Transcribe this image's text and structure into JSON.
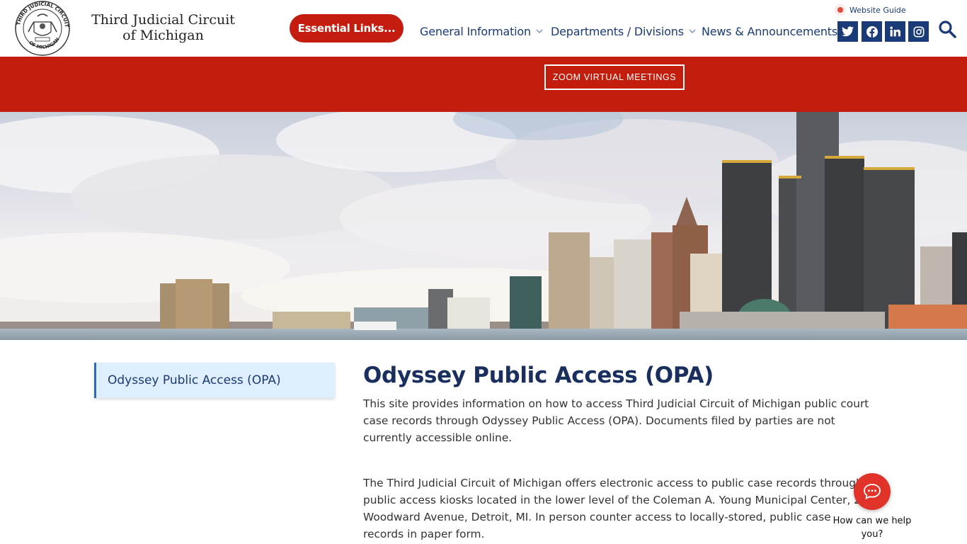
{
  "header": {
    "seal_text_top": "THIRD JUDICIAL CIRCUIT",
    "seal_text_bottom": "OF MICHIGAN",
    "site_title": "Third Judicial Circuit of Michigan",
    "essential_links": "Essential Links...",
    "nav": [
      {
        "label": "General Information",
        "has_dropdown": true
      },
      {
        "label": "Departments / Divisions",
        "has_dropdown": true
      },
      {
        "label": "News & Announcements",
        "has_dropdown": false
      }
    ],
    "website_guide": "Website Guide",
    "social_icons": [
      "twitter-icon",
      "facebook-icon",
      "linkedin-icon",
      "instagram-icon"
    ],
    "search_icon": "search-icon"
  },
  "banner": {
    "zoom_label": "ZOOM VIRTUAL MEETINGS"
  },
  "sidebar": {
    "items": [
      {
        "label": "Odyssey Public Access (OPA)"
      }
    ]
  },
  "main": {
    "title": "Odyssey Public Access (OPA)",
    "paragraphs": [
      "This site provides information on how to access Third Judicial Circuit of Michigan public court case records through Odyssey Public Access (OPA). Documents filed by parties are not currently accessible online.",
      "The Third Judicial Circuit of Michigan offers electronic access to public case records through public access kiosks located in the lower level of the Coleman A. Young Municipal Center, 2 Woodward Avenue, Detroit, MI. In person counter access to locally-stored, public case records in paper form."
    ]
  },
  "chat": {
    "label": "How can we help you?"
  },
  "colors": {
    "brand_red": "#c31d0e",
    "navy": "#1a3a78",
    "sidebar_bg": "#dfeefc"
  }
}
